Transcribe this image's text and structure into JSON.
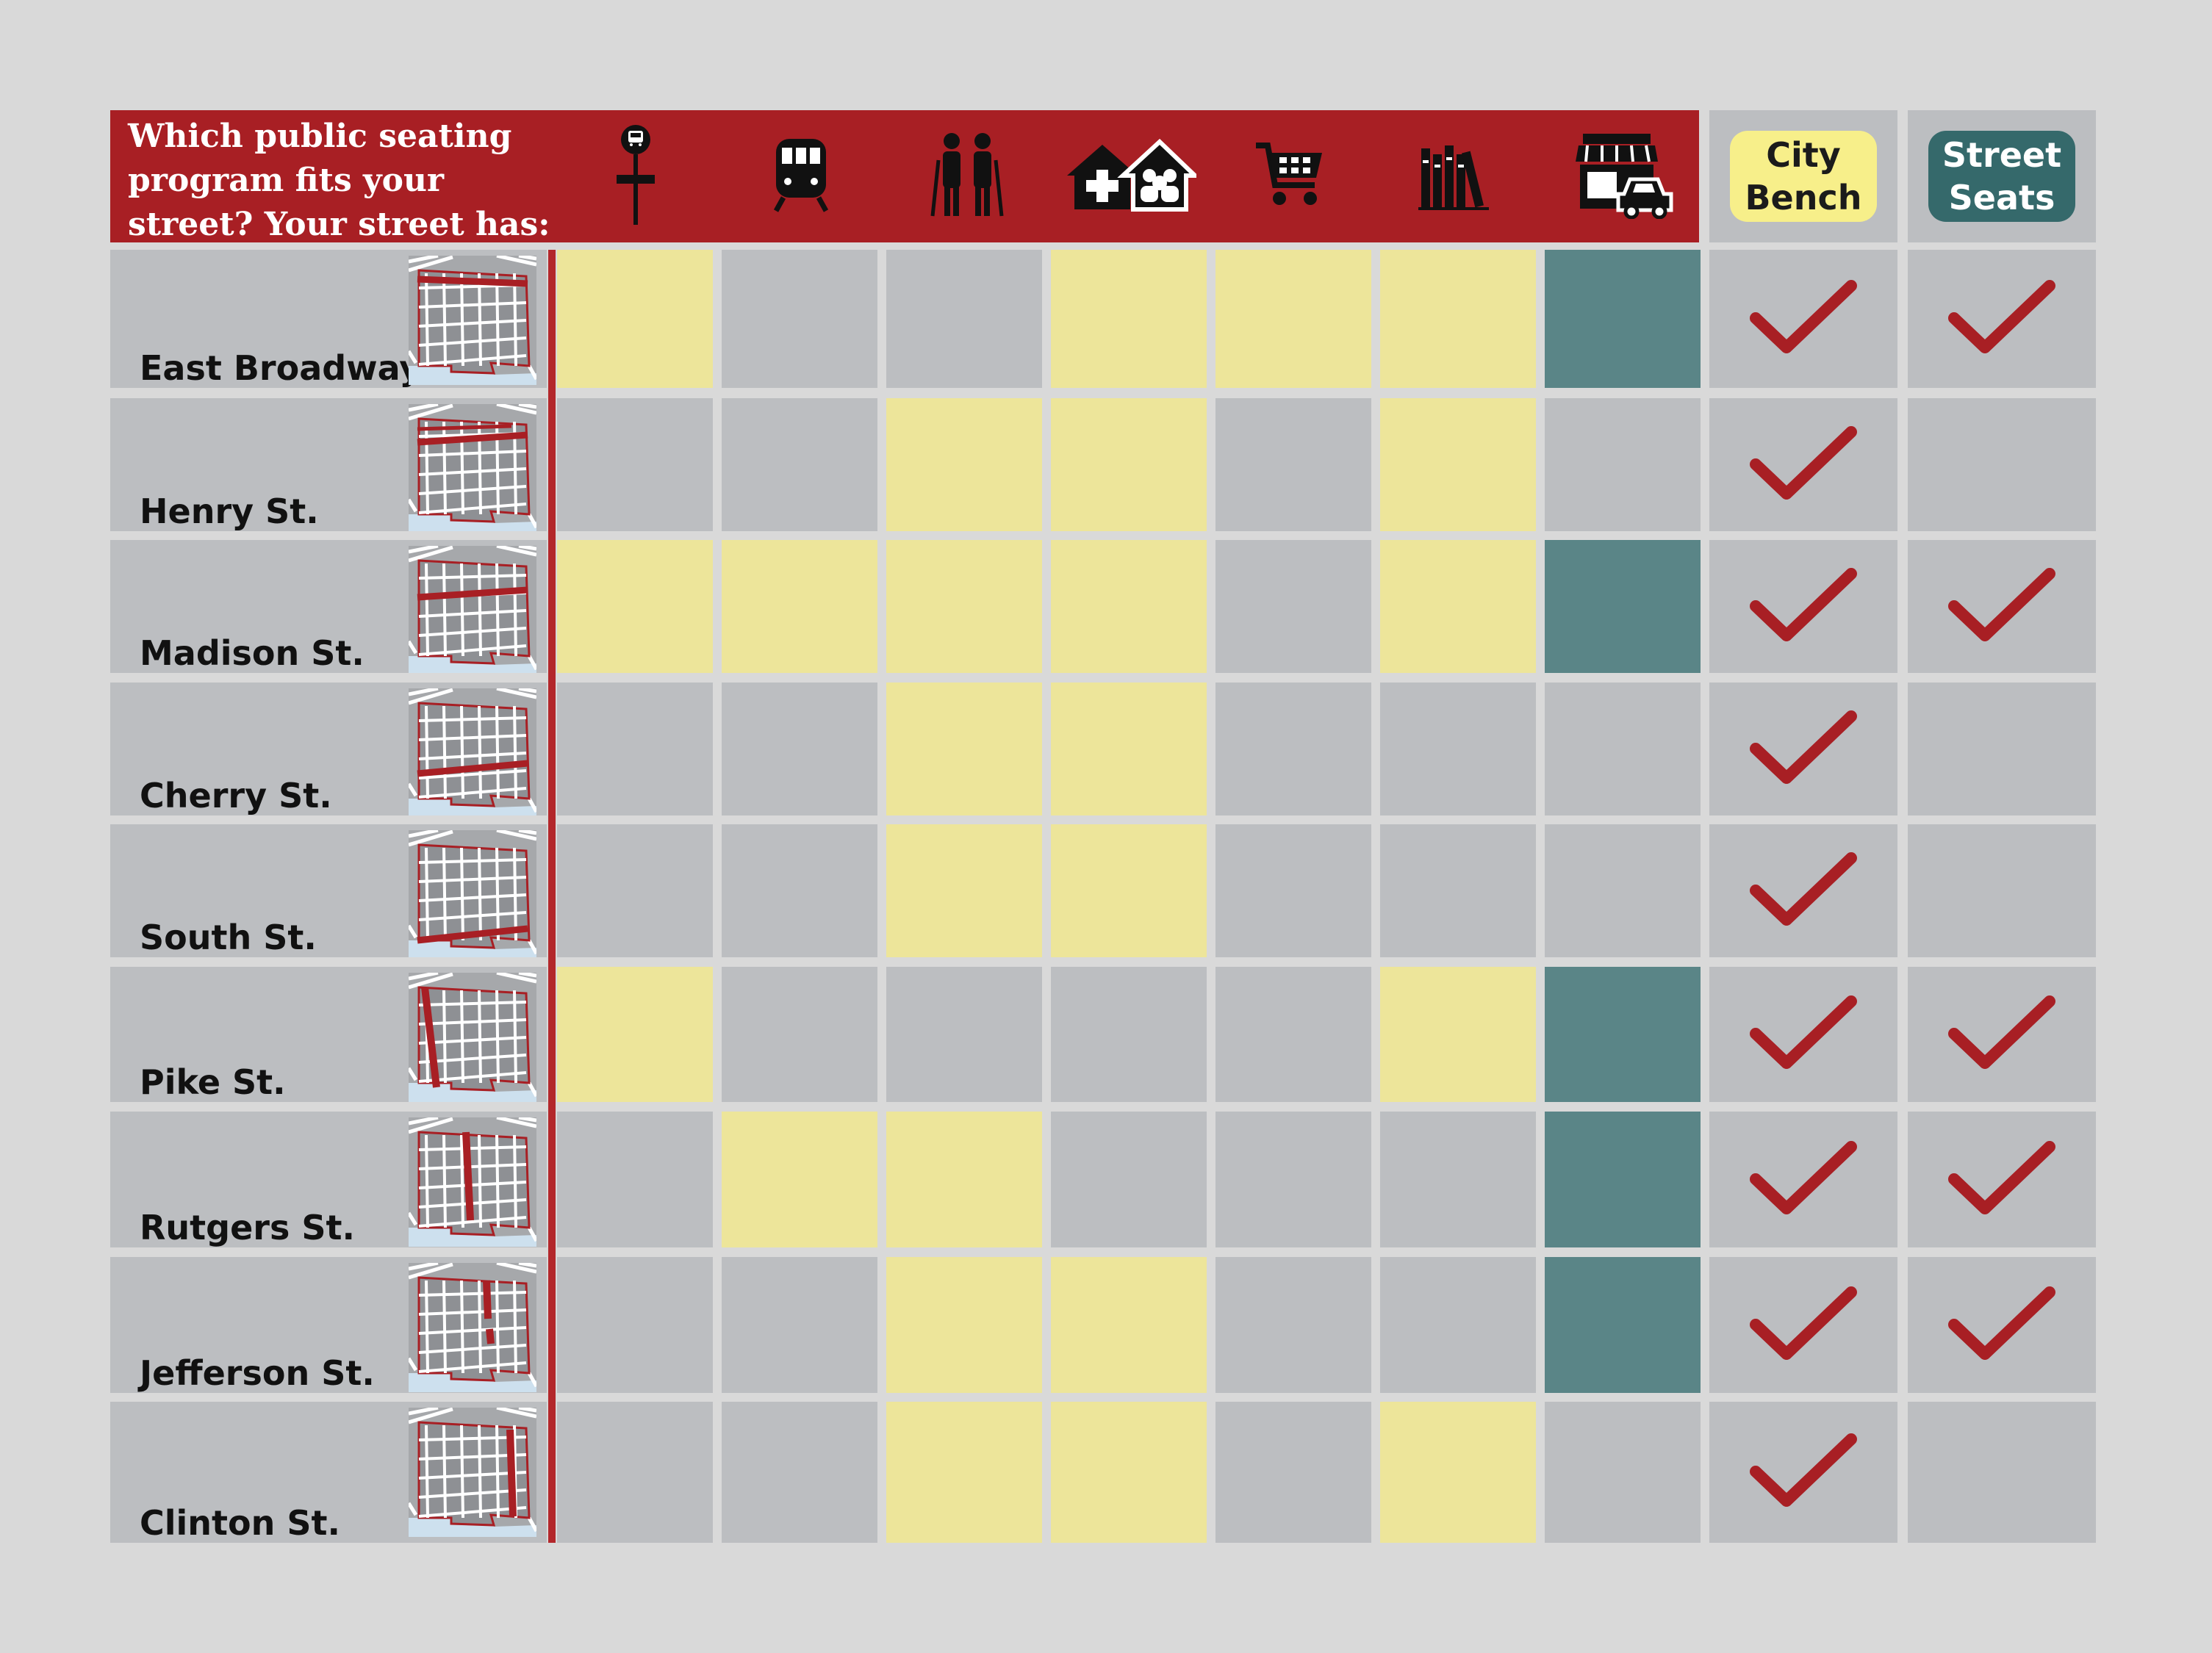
{
  "header": {
    "question": "Which public seating\nprogram fits your\nstreet?  Your street has:"
  },
  "amenity_icons": [
    "bus-stop-icon",
    "subway-icon",
    "seniors-icon",
    "health-community-center-icon",
    "shopping-cart-icon",
    "library-icon",
    "storefront-icon"
  ],
  "programs": [
    {
      "label": "City\nBench",
      "bg": "#f7ef8a",
      "fg": "#1b1b1b"
    },
    {
      "label": "Street\nSeats",
      "bg": "#35696b",
      "fg": "#ffffff"
    }
  ],
  "colors": {
    "header_red": "#a81f24",
    "cell_gray": "#bcbec1",
    "cell_yellow": "#ede59a",
    "cell_teal": "#5a8587",
    "check_red": "#a81f24",
    "background": "#d9d9d9"
  },
  "streets": [
    {
      "name": "East Broadway",
      "amenities": [
        1,
        0,
        0,
        1,
        1,
        1,
        2
      ],
      "city_bench": true,
      "street_seats": true
    },
    {
      "name": "Henry St.",
      "amenities": [
        0,
        0,
        1,
        1,
        0,
        1,
        0
      ],
      "city_bench": true,
      "street_seats": false
    },
    {
      "name": "Madison St.",
      "amenities": [
        1,
        1,
        1,
        1,
        0,
        1,
        2
      ],
      "city_bench": true,
      "street_seats": true
    },
    {
      "name": "Cherry St.",
      "amenities": [
        0,
        0,
        1,
        1,
        0,
        0,
        0
      ],
      "city_bench": true,
      "street_seats": false
    },
    {
      "name": "South St.",
      "amenities": [
        0,
        0,
        1,
        1,
        0,
        0,
        0
      ],
      "city_bench": true,
      "street_seats": false
    },
    {
      "name": "Pike St.",
      "amenities": [
        1,
        0,
        0,
        0,
        0,
        1,
        2
      ],
      "city_bench": true,
      "street_seats": true
    },
    {
      "name": "Rutgers St.",
      "amenities": [
        0,
        1,
        1,
        0,
        0,
        0,
        2
      ],
      "city_bench": true,
      "street_seats": true
    },
    {
      "name": "Jefferson St.",
      "amenities": [
        0,
        0,
        1,
        1,
        0,
        0,
        2
      ],
      "city_bench": true,
      "street_seats": true
    },
    {
      "name": "Clinton St.",
      "amenities": [
        0,
        0,
        1,
        1,
        0,
        1,
        0
      ],
      "city_bench": true,
      "street_seats": false
    }
  ]
}
